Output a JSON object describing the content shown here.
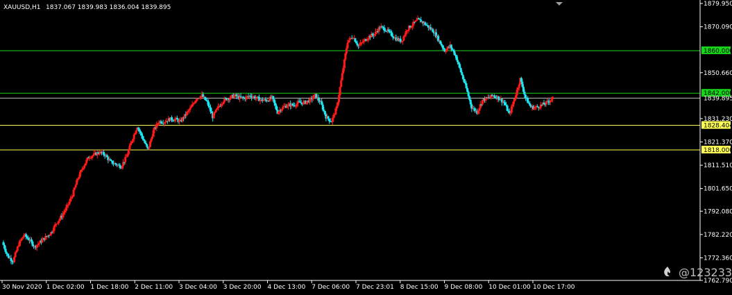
{
  "header": {
    "symbol": "XAUUSD,H1",
    "ohlc": "1837.067 1839.983 1836.004 1839.895"
  },
  "watermark": {
    "text": "@123233",
    "icon": "flame-logo-icon"
  },
  "colors": {
    "background": "#000000",
    "bull": "#ff1a1a",
    "bear": "#1ee5f2",
    "resistance": "#16d61a",
    "support": "#ffff55",
    "current": "#c0c0c0",
    "axis": "#ffffff"
  },
  "chart_data": {
    "type": "candlestick",
    "ylim": [
      1762.79,
      1879.95
    ],
    "y_ticks": [
      "1879.950",
      "1870.090",
      "1850.660",
      "1831.230",
      "1821.370",
      "1811.510",
      "1801.650",
      "1792.080",
      "1782.220",
      "1772.360",
      "1762.790"
    ],
    "x_ticks": [
      "30 Nov 2020",
      "1 Dec 02:00",
      "1 Dec 18:00",
      "2 Dec 11:00",
      "3 Dec 04:00",
      "3 Dec 20:00",
      "4 Dec 13:00",
      "7 Dec 06:00",
      "7 Dec 23:01",
      "8 Dec 15:00",
      "9 Dec 08:00",
      "10 Dec 01:00",
      "10 Dec 17:00"
    ],
    "levels": [
      {
        "label": "1860.000",
        "value": 1860.0,
        "kind": "resistance"
      },
      {
        "label": "1842.000",
        "value": 1842.0,
        "kind": "resistance"
      },
      {
        "label": "1839.895",
        "value": 1839.895,
        "kind": "current"
      },
      {
        "label": "1828.404",
        "value": 1828.404,
        "kind": "support"
      },
      {
        "label": "1818.000",
        "value": 1818.0,
        "kind": "support"
      }
    ],
    "close_path": [
      1779,
      1773,
      1771,
      1778,
      1782,
      1780,
      1777,
      1779,
      1781,
      1783,
      1787,
      1790,
      1794,
      1799,
      1806,
      1811,
      1815,
      1816,
      1817,
      1816,
      1813,
      1812,
      1811,
      1815,
      1822,
      1828,
      1823,
      1818,
      1826,
      1830,
      1830,
      1831,
      1831,
      1830,
      1833,
      1836,
      1840,
      1841,
      1838,
      1832,
      1836,
      1839,
      1840,
      1841,
      1840,
      1840,
      1841,
      1840,
      1839,
      1839,
      1840,
      1834,
      1836,
      1837,
      1837,
      1838,
      1838,
      1839,
      1841,
      1838,
      1832,
      1830,
      1836,
      1850,
      1864,
      1866,
      1862,
      1864,
      1866,
      1867,
      1870,
      1869,
      1867,
      1865,
      1864,
      1869,
      1871,
      1873,
      1872,
      1870,
      1868,
      1864,
      1860,
      1862,
      1858,
      1851,
      1844,
      1836,
      1834,
      1839,
      1840,
      1841,
      1840,
      1838,
      1833,
      1840,
      1848,
      1840,
      1836,
      1836,
      1837,
      1838,
      1840
    ]
  }
}
